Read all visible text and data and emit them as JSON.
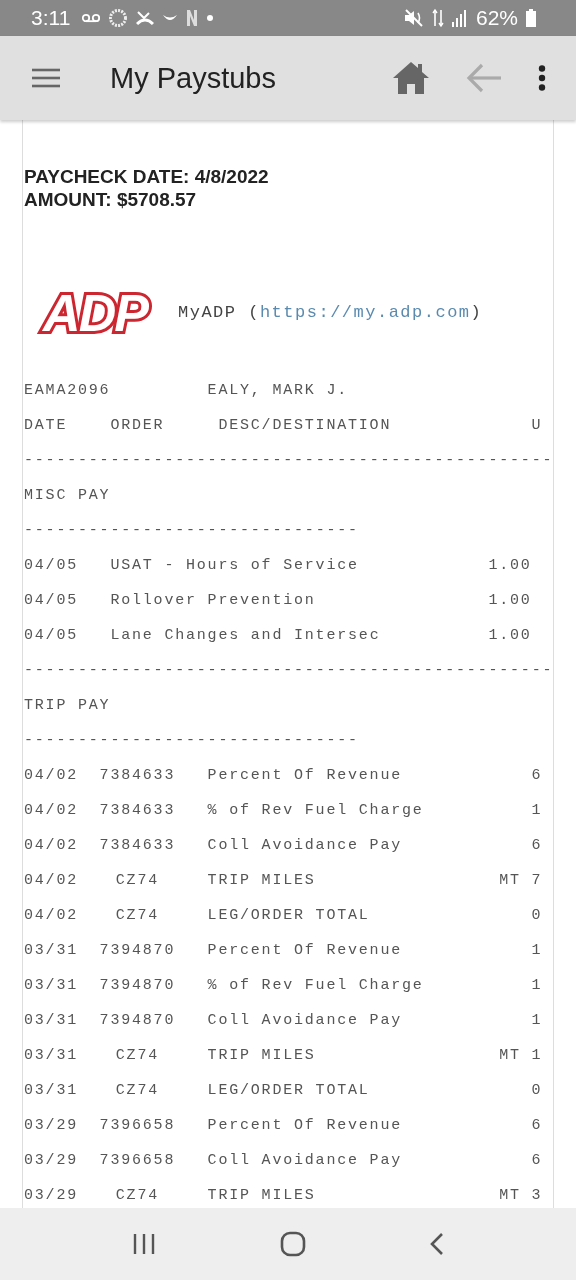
{
  "status_bar": {
    "time": "3:11",
    "battery": "62%"
  },
  "app_bar": {
    "title": "My Paystubs"
  },
  "paycheck": {
    "date_line": "PAYCHECK DATE: 4/8/2022",
    "amount_line": "AMOUNT: $5708.57"
  },
  "logo": {
    "text": "ADP"
  },
  "site": {
    "label": "MyADP (",
    "url": "https://my.adp.com",
    "suffix": ")"
  },
  "employee": {
    "id": "EAMA2096",
    "name": "EALY, MARK J."
  },
  "columns": [
    "DATE",
    "ORDER",
    "DESC/DESTINATION",
    "U"
  ],
  "sections": [
    {
      "rule_above": "-------------------------------------------------",
      "title": "MISC PAY",
      "rule_below": "-------------------------------",
      "rows": [
        {
          "kind": "misc",
          "date": "04/05",
          "desc": "USAT - Hours of Service",
          "amount": "1.00"
        },
        {
          "kind": "misc",
          "date": "04/05",
          "desc": "Rollover Prevention",
          "amount": "1.00"
        },
        {
          "kind": "misc",
          "date": "04/05",
          "desc": "Lane Changes and Intersec",
          "amount": "1.00"
        }
      ]
    },
    {
      "rule_above": "-------------------------------------------------",
      "title": "TRIP PAY",
      "rule_below": "-------------------------------",
      "rows": [
        {
          "kind": "trip",
          "date": "04/02",
          "order": "7384633",
          "desc": "Percent Of Revenue",
          "amount": "6"
        },
        {
          "kind": "trip",
          "date": "04/02",
          "order": "7384633",
          "desc": "% of Rev Fuel Charge",
          "amount": "1"
        },
        {
          "kind": "trip",
          "date": "04/02",
          "order": "7384633",
          "desc": "Coll Avoidance Pay",
          "amount": "6"
        },
        {
          "kind": "trip",
          "date": "04/02",
          "order": "CZ74",
          "desc": "TRIP MILES",
          "unit": "MT",
          "amount": "7"
        },
        {
          "kind": "trip",
          "date": "04/02",
          "order": "CZ74",
          "desc": "LEG/ORDER TOTAL",
          "amount": "0"
        },
        {
          "kind": "trip",
          "date": "03/31",
          "order": "7394870",
          "desc": "Percent Of Revenue",
          "amount": "1"
        },
        {
          "kind": "trip",
          "date": "03/31",
          "order": "7394870",
          "desc": "% of Rev Fuel Charge",
          "amount": "1"
        },
        {
          "kind": "trip",
          "date": "03/31",
          "order": "7394870",
          "desc": "Coll Avoidance Pay",
          "amount": "1"
        },
        {
          "kind": "trip",
          "date": "03/31",
          "order": "CZ74",
          "desc": "TRIP MILES",
          "unit": "MT",
          "amount": "1"
        },
        {
          "kind": "trip",
          "date": "03/31",
          "order": "CZ74",
          "desc": "LEG/ORDER TOTAL",
          "amount": "0"
        },
        {
          "kind": "trip",
          "date": "03/29",
          "order": "7396658",
          "desc": "Percent Of Revenue",
          "amount": "6"
        },
        {
          "kind": "trip",
          "date": "03/29",
          "order": "7396658",
          "desc": "Coll Avoidance Pay",
          "amount": "6"
        },
        {
          "kind": "trip",
          "date": "03/29",
          "order": "CZ74",
          "desc": "TRIP MILES",
          "unit": "MT",
          "amount": "3"
        }
      ]
    }
  ]
}
